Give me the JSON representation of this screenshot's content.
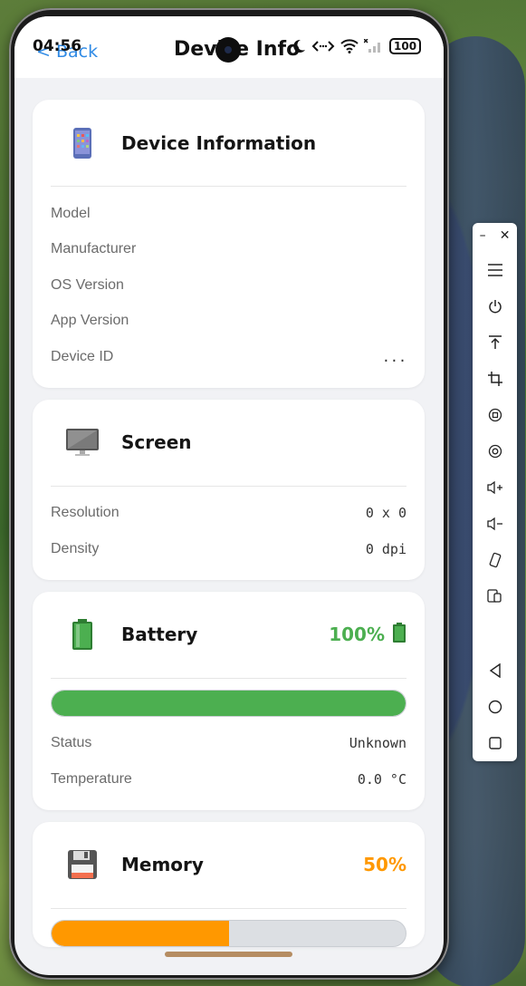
{
  "status_bar": {
    "time": "04:56",
    "battery": "100"
  },
  "nav": {
    "back_label": "< Back",
    "title": "Device Info"
  },
  "device_info": {
    "title": "Device Information",
    "icon": "phone-icon",
    "rows": [
      {
        "label": "Model",
        "value": ""
      },
      {
        "label": "Manufacturer",
        "value": ""
      },
      {
        "label": "OS Version",
        "value": ""
      },
      {
        "label": "App Version",
        "value": ""
      },
      {
        "label": "Device ID",
        "value": "..."
      }
    ]
  },
  "screen": {
    "title": "Screen",
    "icon": "monitor-icon",
    "rows": [
      {
        "label": "Resolution",
        "value": "0 x 0"
      },
      {
        "label": "Density",
        "value": "0 dpi"
      }
    ]
  },
  "battery": {
    "title": "Battery",
    "icon": "battery-icon",
    "badge": "100%",
    "level": 1.0,
    "color": "#4caf50",
    "rows": [
      {
        "label": "Status",
        "value": "Unknown"
      },
      {
        "label": "Temperature",
        "value": "0.0 °C"
      }
    ]
  },
  "memory": {
    "title": "Memory",
    "icon": "floppy-disk-icon",
    "badge": "50%",
    "level": 0.5,
    "color": "#ff9800"
  },
  "toolbar": {
    "items": [
      "menu-icon",
      "power-icon",
      "upload-icon",
      "crop-icon",
      "rotate-icon",
      "record-icon",
      "volume-up-icon",
      "volume-down-icon",
      "shake-icon",
      "multi-screen-icon",
      "back-nav-icon",
      "home-nav-icon",
      "recents-nav-icon"
    ]
  }
}
